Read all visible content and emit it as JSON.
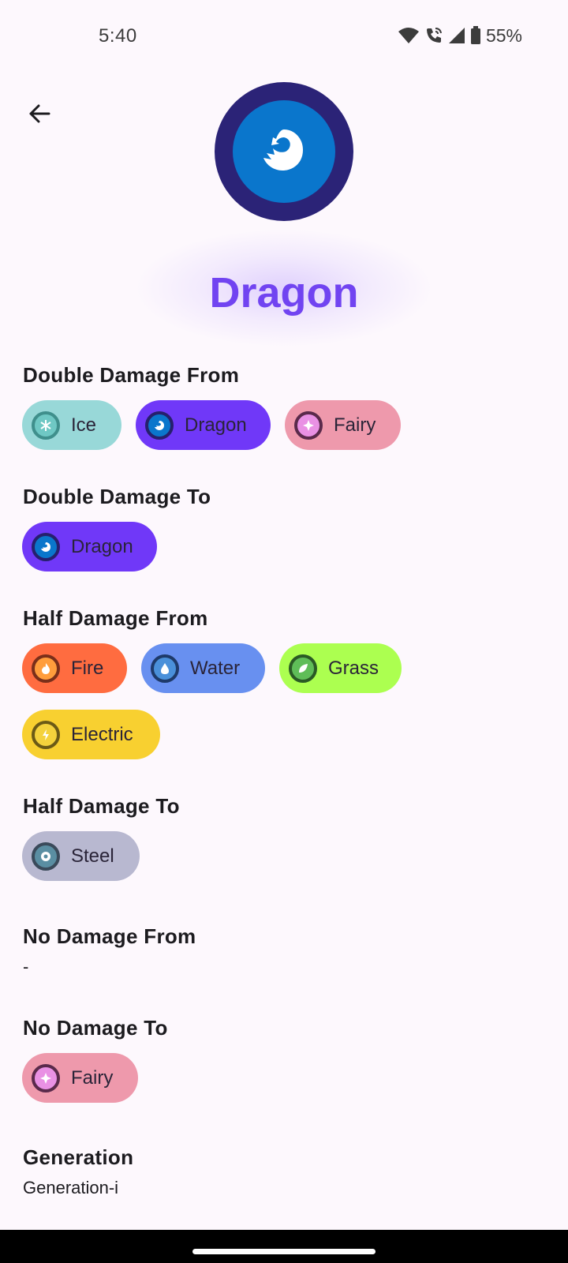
{
  "status_bar": {
    "time": "5:40",
    "battery": "55%"
  },
  "header": {
    "back_icon": "arrow-left-icon",
    "type_icon": "dragon-icon",
    "title": "Dragon",
    "title_color": "#7144f1"
  },
  "sections": {
    "double_damage_from": {
      "heading": "Double Damage From",
      "chips": [
        {
          "label": "Ice",
          "bg": "#98d8d8"
        },
        {
          "label": "Dragon",
          "bg": "#7038f8"
        },
        {
          "label": "Fairy",
          "bg": "#ee99ac"
        }
      ]
    },
    "double_damage_to": {
      "heading": "Double Damage To",
      "chips": [
        {
          "label": "Dragon",
          "bg": "#7038f8"
        }
      ]
    },
    "half_damage_from": {
      "heading": "Half Damage From",
      "chips": [
        {
          "label": "Fire",
          "bg": "#ff6c40"
        },
        {
          "label": "Water",
          "bg": "#6890f0"
        },
        {
          "label": "Grass",
          "bg": "#acff50"
        },
        {
          "label": "Electric",
          "bg": "#f8d030"
        }
      ]
    },
    "half_damage_to": {
      "heading": "Half Damage To",
      "chips": [
        {
          "label": "Steel",
          "bg": "#b8b8d0"
        }
      ]
    },
    "no_damage_from": {
      "heading": "No Damage From",
      "value": "-"
    },
    "no_damage_to": {
      "heading": "No Damage To",
      "chips": [
        {
          "label": "Fairy",
          "bg": "#ee99ac"
        }
      ]
    },
    "generation": {
      "heading": "Generation",
      "value": "Generation-i"
    }
  }
}
